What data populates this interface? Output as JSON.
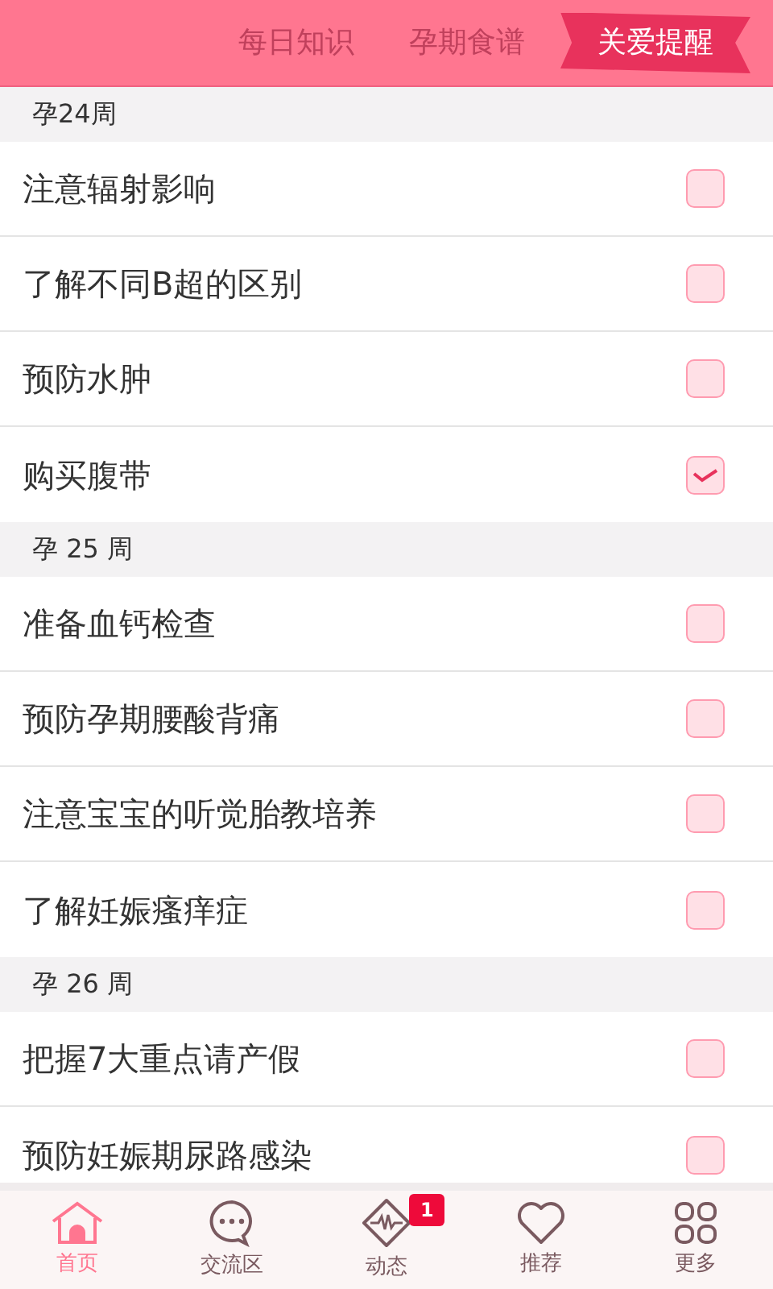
{
  "tabs": [
    {
      "label": "每日知识",
      "selected": false
    },
    {
      "label": "孕期食谱",
      "selected": false
    },
    {
      "label": "关爱提醒",
      "selected": true
    }
  ],
  "sections": [
    {
      "title": "孕24周",
      "items": [
        {
          "label": "注意辐射影响",
          "checked": false
        },
        {
          "label": "了解不同B超的区别",
          "checked": false
        },
        {
          "label": "预防水肿",
          "checked": false
        },
        {
          "label": "购买腹带",
          "checked": true
        }
      ]
    },
    {
      "title": "孕 25 周",
      "items": [
        {
          "label": "准备血钙检查",
          "checked": false
        },
        {
          "label": "预防孕期腰酸背痛",
          "checked": false
        },
        {
          "label": "注意宝宝的听觉胎教培养",
          "checked": false
        },
        {
          "label": "了解妊娠瘙痒症",
          "checked": false
        }
      ]
    },
    {
      "title": "孕 26 周",
      "items": [
        {
          "label": "把握7大重点请产假",
          "checked": false
        },
        {
          "label": "预防妊娠期尿路感染",
          "checked": false
        }
      ]
    }
  ],
  "nav": [
    {
      "kind": "home",
      "label": "首页",
      "selected": true
    },
    {
      "kind": "chat",
      "label": "交流区",
      "selected": false
    },
    {
      "kind": "pulse",
      "label": "动态",
      "selected": false,
      "badge": "1"
    },
    {
      "kind": "heart",
      "label": "推荐",
      "selected": false
    },
    {
      "kind": "grid",
      "label": "更多",
      "selected": false
    }
  ]
}
